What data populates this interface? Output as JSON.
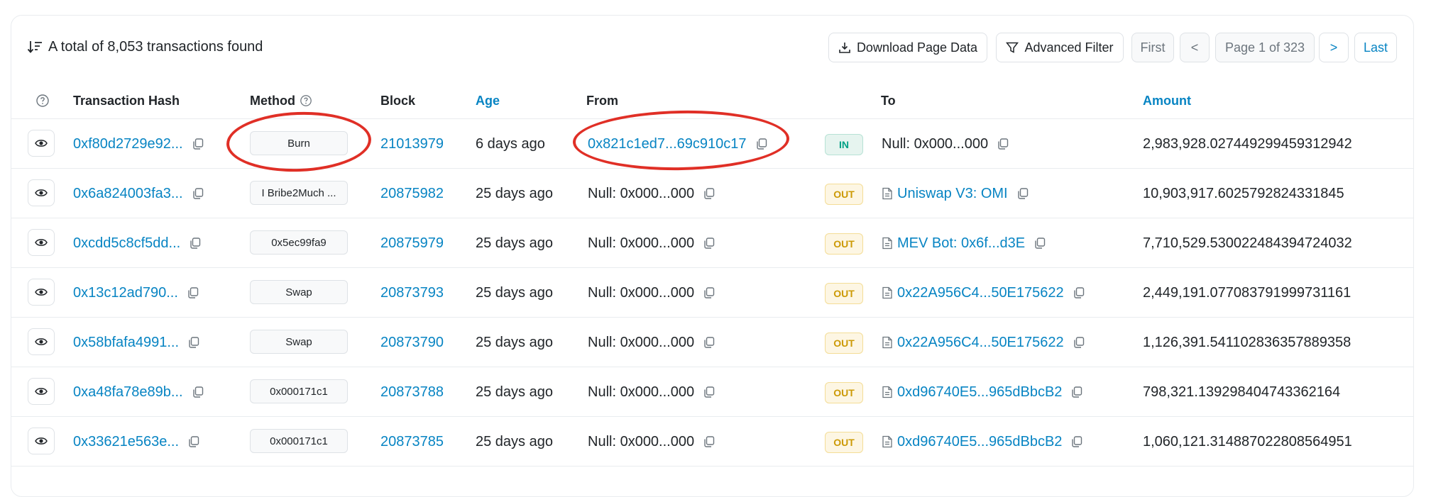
{
  "summary": {
    "text": "A total of 8,053 transactions found"
  },
  "toolbar": {
    "download_label": "Download Page Data",
    "filter_label": "Advanced Filter",
    "first_label": "First",
    "prev_label": "<",
    "page_label": "Page 1 of 323",
    "next_label": ">",
    "last_label": "Last"
  },
  "columns": {
    "hash": "Transaction Hash",
    "method": "Method",
    "block": "Block",
    "age": "Age",
    "from": "From",
    "to": "To",
    "amount": "Amount"
  },
  "rows": [
    {
      "hash": "0xf80d2729e92...",
      "method": "Burn",
      "block": "21013979",
      "age": "6 days ago",
      "from": "0x821c1ed7...69c910c17",
      "direction": "IN",
      "to": "Null: 0x000...000",
      "amount": "2,983,928.027449299459312942"
    },
    {
      "hash": "0x6a824003fa3...",
      "method": "I Bribe2Much ...",
      "block": "20875982",
      "age": "25 days ago",
      "from": "Null: 0x000...000",
      "direction": "OUT",
      "to": "Uniswap V3: OMI",
      "amount": "10,903,917.6025792824331845"
    },
    {
      "hash": "0xcdd5c8cf5dd...",
      "method": "0x5ec99fa9",
      "block": "20875979",
      "age": "25 days ago",
      "from": "Null: 0x000...000",
      "direction": "OUT",
      "to": "MEV Bot: 0x6f...d3E",
      "amount": "7,710,529.530022484394724032"
    },
    {
      "hash": "0x13c12ad790...",
      "method": "Swap",
      "block": "20873793",
      "age": "25 days ago",
      "from": "Null: 0x000...000",
      "direction": "OUT",
      "to": "0x22A956C4...50E175622",
      "amount": "2,449,191.077083791999731161"
    },
    {
      "hash": "0x58bfafa4991...",
      "method": "Swap",
      "block": "20873790",
      "age": "25 days ago",
      "from": "Null: 0x000...000",
      "direction": "OUT",
      "to": "0x22A956C4...50E175622",
      "amount": "1,126,391.541102836357889358"
    },
    {
      "hash": "0xa48fa78e89b...",
      "method": "0x000171c1",
      "block": "20873788",
      "age": "25 days ago",
      "from": "Null: 0x000...000",
      "direction": "OUT",
      "to": "0xd96740E5...965dBbcB2",
      "amount": "798,321.139298404743362164"
    },
    {
      "hash": "0x33621e563e...",
      "method": "0x000171c1",
      "block": "20873785",
      "age": "25 days ago",
      "from": "Null: 0x000...000",
      "direction": "OUT",
      "to": "0xd96740E5...965dBbcB2",
      "amount": "1,060,121.314887022808564951"
    }
  ],
  "colors": {
    "link": "#0784c3",
    "in_badge": "#00a186",
    "out_badge": "#cc9a06",
    "annotation_circle": "#e02f26"
  },
  "icons": [
    "sort-icon",
    "download-icon",
    "filter-icon",
    "help-icon",
    "eye-icon",
    "copy-icon",
    "document-icon"
  ]
}
